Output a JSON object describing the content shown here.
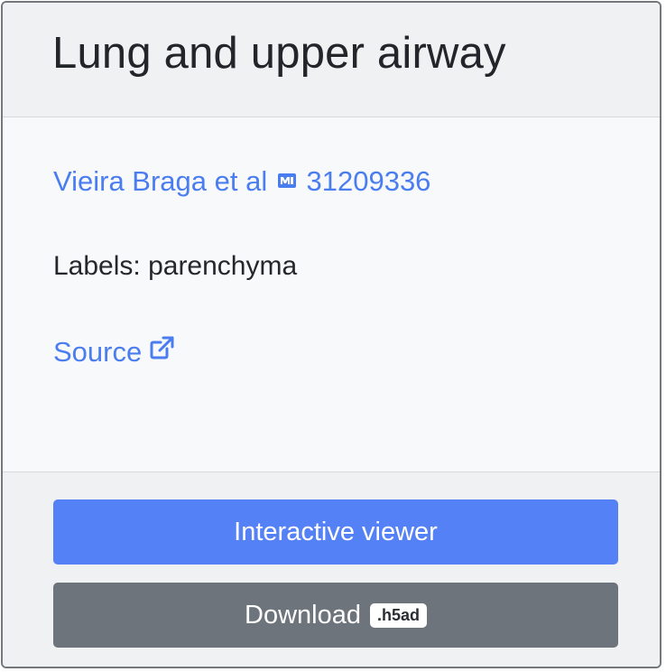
{
  "card": {
    "title": "Lung and upper airway",
    "reference": {
      "authors": "Vieira Braga et al",
      "pmid_icon": "pubmed-icon",
      "pmid": "31209336"
    },
    "labels_text": "Labels: parenchyma",
    "source_label": "Source",
    "source_icon": "external-link-icon"
  },
  "footer": {
    "viewer_button_label": "Interactive viewer",
    "download_button_label": "Download",
    "download_format_badge": ".h5ad"
  },
  "colors": {
    "link": "#4a7df0",
    "primary_button": "#5581f6",
    "secondary_button": "#6d747b"
  }
}
